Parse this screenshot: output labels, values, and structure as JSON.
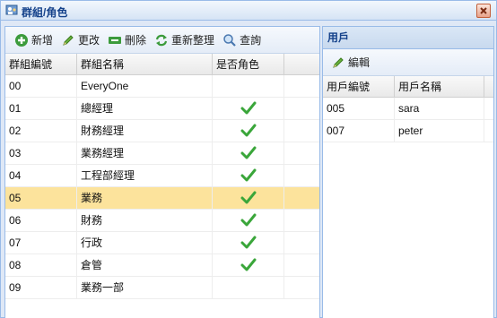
{
  "window": {
    "title": "群組/角色",
    "icon": "app-window-icon",
    "close_icon": "close-icon"
  },
  "left_toolbar": [
    {
      "name": "add-button",
      "icon": "add-icon",
      "label": "新增"
    },
    {
      "name": "edit-button",
      "icon": "pencil-icon",
      "label": "更改"
    },
    {
      "name": "delete-button",
      "icon": "remove-icon",
      "label": "刪除"
    },
    {
      "name": "refresh-button",
      "icon": "refresh-icon",
      "label": "重新整理"
    },
    {
      "name": "search-button",
      "icon": "search-icon",
      "label": "查詢"
    }
  ],
  "groups_grid": {
    "columns": [
      "群組編號",
      "群組名稱",
      "是否角色"
    ],
    "rows": [
      {
        "id": "00",
        "name": "EveryOne",
        "is_role": false,
        "selected": false
      },
      {
        "id": "01",
        "name": "總經理",
        "is_role": true,
        "selected": false
      },
      {
        "id": "02",
        "name": "財務經理",
        "is_role": true,
        "selected": false
      },
      {
        "id": "03",
        "name": "業務經理",
        "is_role": true,
        "selected": false
      },
      {
        "id": "04",
        "name": "工程部經理",
        "is_role": true,
        "selected": false
      },
      {
        "id": "05",
        "name": "業務",
        "is_role": true,
        "selected": true
      },
      {
        "id": "06",
        "name": "財務",
        "is_role": true,
        "selected": false
      },
      {
        "id": "07",
        "name": "行政",
        "is_role": true,
        "selected": false
      },
      {
        "id": "08",
        "name": "倉管",
        "is_role": true,
        "selected": false
      },
      {
        "id": "09",
        "name": "業務一部",
        "is_role": false,
        "selected": false
      }
    ]
  },
  "users_panel": {
    "title": "用戶",
    "toolbar": [
      {
        "name": "edit-users-button",
        "icon": "pencil-icon",
        "label": "編輯"
      }
    ],
    "columns": [
      "用戶編號",
      "用戶名稱"
    ],
    "rows": [
      {
        "id": "005",
        "name": "sara"
      },
      {
        "id": "007",
        "name": "peter"
      }
    ]
  },
  "colors": {
    "selected_row": "#fce39c",
    "panel_border": "#99bbe8",
    "title_text": "#15428b",
    "check_green": "#3aa63a"
  }
}
